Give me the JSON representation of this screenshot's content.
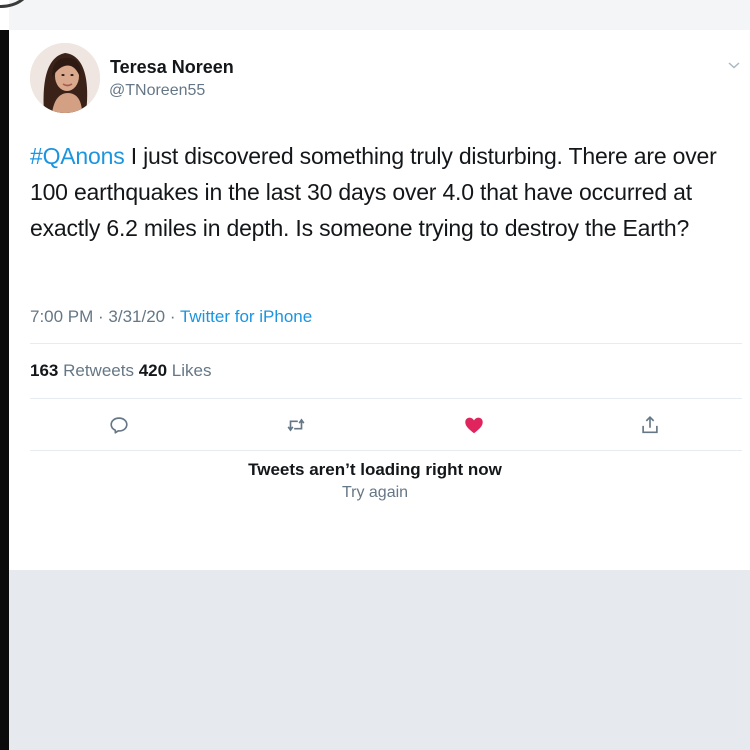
{
  "tweet": {
    "author_name": "Teresa Noreen",
    "author_handle": "@TNoreen55",
    "hashtag": "#QAnons",
    "text": " I just discovered something truly disturbing. There are over 100 earthquakes in the last 30 days over 4.0 that have occurred at exactly 6.2 miles in depth. Is someone trying to destroy the Earth?",
    "timestamp": "7:00 PM · 3/31/20 · ",
    "source": "Twitter for iPhone",
    "retweets_count": "163",
    "retweets_label": " Retweets ",
    "likes_count": "420",
    "likes_label": " Likes"
  },
  "actions": {
    "reply_icon": "reply-icon",
    "retweet_icon": "retweet-icon",
    "like_icon": "heart-icon",
    "share_icon": "share-icon"
  },
  "error": {
    "title": "Tweets aren’t loading right now",
    "retry": "Try again"
  },
  "colors": {
    "link": "#1b95e0",
    "secondary_text": "#657786",
    "like_active": "#e0245e",
    "divider": "#e6ecf0",
    "bottom_panel": "#e6e9ee"
  }
}
